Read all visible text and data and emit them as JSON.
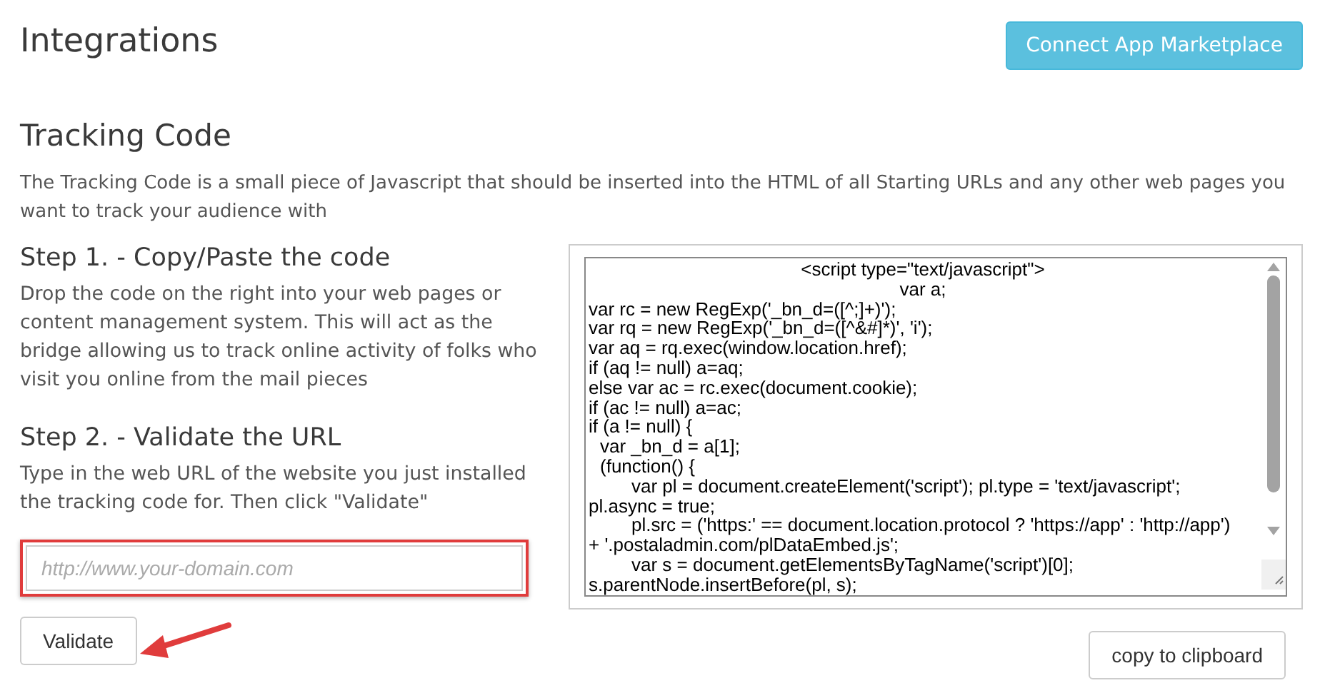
{
  "header": {
    "title": "Integrations",
    "action_button": "Connect App Marketplace"
  },
  "section": {
    "title": "Tracking Code",
    "description": "The Tracking Code is a small piece of Javascript that should be inserted into the HTML of all Starting URLs and any other web pages you want to track your audience with"
  },
  "steps": [
    {
      "title": "Step 1. - Copy/Paste the code",
      "text": "Drop the code on the right into your web pages or content management system. This will act as the bridge allowing us to track online activity of folks who visit you online from the mail pieces"
    },
    {
      "title": "Step 2. - Validate the URL",
      "text": "Type in the web URL of the website you just installed the tracking code for. Then click \"Validate\""
    }
  ],
  "url_field": {
    "placeholder": "http://www.your-domain.com"
  },
  "validate_button": "Validate",
  "code_box": {
    "lines": [
      {
        "kind": "center",
        "text": "<script type=\"text/javascript\">"
      },
      {
        "kind": "center",
        "text": "var a;"
      },
      {
        "kind": "plain",
        "text": "var rc = new RegExp('_bn_d=([^;]+)');"
      },
      {
        "kind": "plain",
        "text": "var rq = new RegExp('_bn_d=([^&#]*)', 'i');"
      },
      {
        "kind": "plain",
        "text": "var aq = rq.exec(window.location.href);"
      },
      {
        "kind": "plain",
        "text": "if (aq != null) a=aq;"
      },
      {
        "kind": "plain",
        "text": "else var ac = rc.exec(document.cookie);"
      },
      {
        "kind": "plain",
        "text": "if (ac != null) a=ac;"
      },
      {
        "kind": "plain",
        "text": "if (a != null) {"
      },
      {
        "kind": "indent",
        "text": "var _bn_d = a[1];"
      },
      {
        "kind": "indent",
        "text": "(function() {"
      },
      {
        "kind": "deep",
        "text": "var pl = document.createElement('script'); pl.type = 'text/javascript';"
      },
      {
        "kind": "plain",
        "text": "pl.async = true;"
      },
      {
        "kind": "deep",
        "text": "pl.src = ('https:' == document.location.protocol ? 'https://app' : 'http://app')"
      },
      {
        "kind": "plain",
        "text": "+ '.postaladmin.com/plDataEmbed.js';"
      },
      {
        "kind": "deep",
        "text": "var s = document.getElementsByTagName('script')[0];"
      },
      {
        "kind": "plain",
        "text": "s.parentNode.insertBefore(pl, s);"
      }
    ]
  },
  "copy_button": "copy to clipboard"
}
